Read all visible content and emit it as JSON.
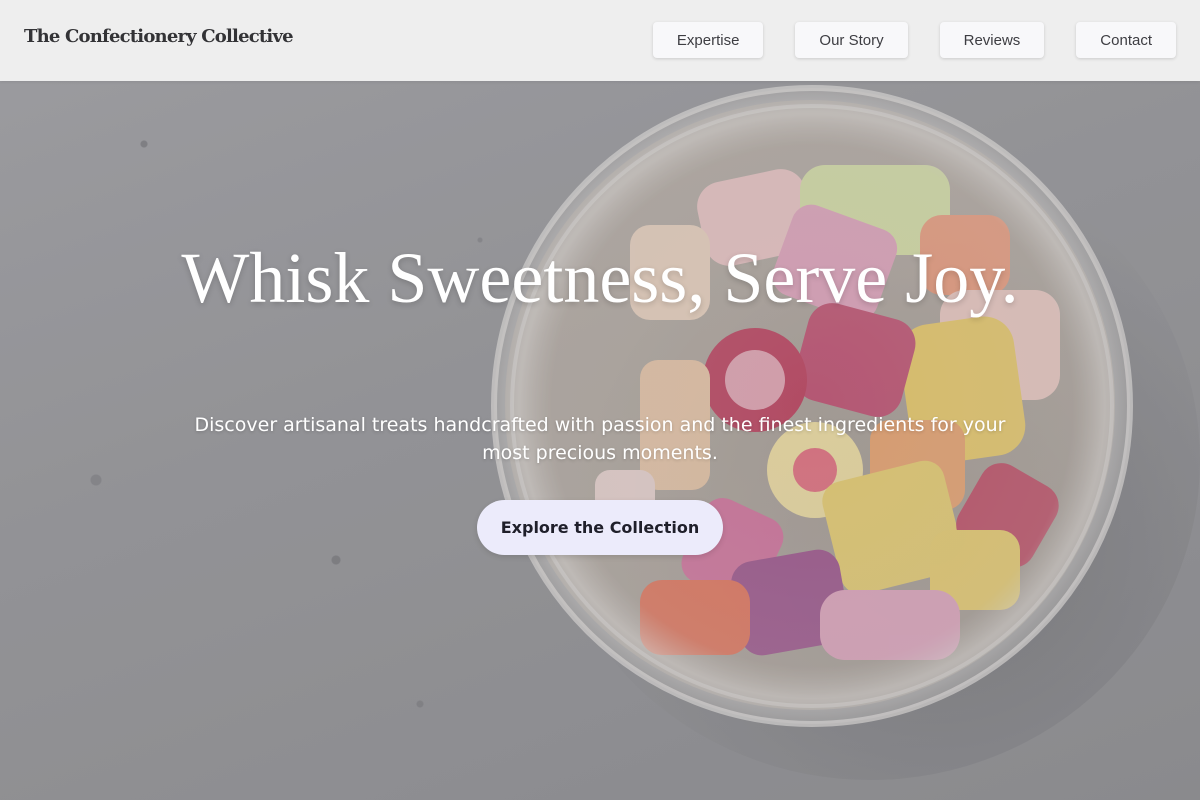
{
  "nav": {
    "brand": "The Confectionery Collective",
    "links": [
      {
        "label": "Expertise"
      },
      {
        "label": "Our Story"
      },
      {
        "label": "Reviews"
      },
      {
        "label": "Contact"
      }
    ]
  },
  "hero": {
    "title": "Whisk Sweetness, Serve Joy.",
    "subtitle": "Discover artisanal treats handcrafted with passion and the finest ingredients for your most precious moments.",
    "cta_label": "Explore the Collection",
    "background_image": "glass jar of colorful hard candies on grey surface"
  },
  "colors": {
    "nav_background": "#f1f1f1",
    "cta_background": "#ecebfb",
    "cta_text": "#1f1f2a",
    "hero_text": "#ffffff"
  }
}
